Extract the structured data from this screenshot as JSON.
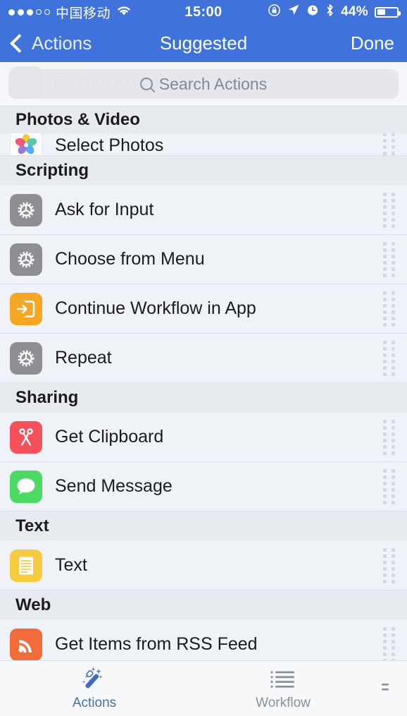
{
  "status_bar": {
    "signal_dots_filled": 3,
    "signal_dots_empty": 2,
    "carrier": "中国移动",
    "wifi_icon": "wifi-icon",
    "time": "15:00",
    "rotation_lock_icon": "rotation-lock-icon",
    "location_icon": "location-arrow-icon",
    "alarm_icon": "alarm-clock-icon",
    "bluetooth_icon": "bluetooth-icon",
    "battery_percent": "44%",
    "battery_icon": "battery-icon"
  },
  "nav_bar": {
    "back_label": "Actions",
    "back_icon": "chevron-left-icon",
    "title": "Suggested",
    "done_label": "Done"
  },
  "search": {
    "placeholder": "Search Actions",
    "value": "",
    "icon": "search-icon",
    "ghost_row_label": "Record Audio"
  },
  "sections": [
    {
      "header": "Photos & Video",
      "rows": [
        {
          "label": "Select Photos",
          "icon": "photos-app-icon",
          "icon_style": "photos",
          "partial": true
        }
      ]
    },
    {
      "header": "Scripting",
      "rows": [
        {
          "label": "Ask for Input",
          "icon": "gear-icon",
          "icon_style": "gear",
          "partial": false
        },
        {
          "label": "Choose from Menu",
          "icon": "gear-icon",
          "icon_style": "gear",
          "partial": false
        },
        {
          "label": "Continue Workflow in App",
          "icon": "arrow-into-box-icon",
          "icon_style": "orange",
          "partial": false
        },
        {
          "label": "Repeat",
          "icon": "gear-icon",
          "icon_style": "gear",
          "partial": false
        }
      ]
    },
    {
      "header": "Sharing",
      "rows": [
        {
          "label": "Get Clipboard",
          "icon": "scissors-icon",
          "icon_style": "red",
          "partial": false
        },
        {
          "label": "Send Message",
          "icon": "message-bubble-icon",
          "icon_style": "green",
          "partial": false
        }
      ]
    },
    {
      "header": "Text",
      "rows": [
        {
          "label": "Text",
          "icon": "document-lines-icon",
          "icon_style": "yellow",
          "partial": false
        }
      ]
    },
    {
      "header": "Web",
      "rows": [
        {
          "label": "Get Items from RSS Feed",
          "icon": "rss-icon",
          "icon_style": "rss",
          "partial": false
        }
      ]
    }
  ],
  "row_drag_handle_icon": "drag-handle-icon",
  "tab_bar": {
    "tabs": [
      {
        "label": "Actions",
        "icon": "magic-wand-icon",
        "active": true
      },
      {
        "label": "Workflow",
        "icon": "list-lines-icon",
        "active": false
      }
    ]
  },
  "colors": {
    "nav_bar": "#3F72DB",
    "row_background": "#EFF2F6",
    "section_header_background": "#E7EAEE",
    "tab_active": "#4A6FA5",
    "tab_inactive": "#8A8F98"
  }
}
